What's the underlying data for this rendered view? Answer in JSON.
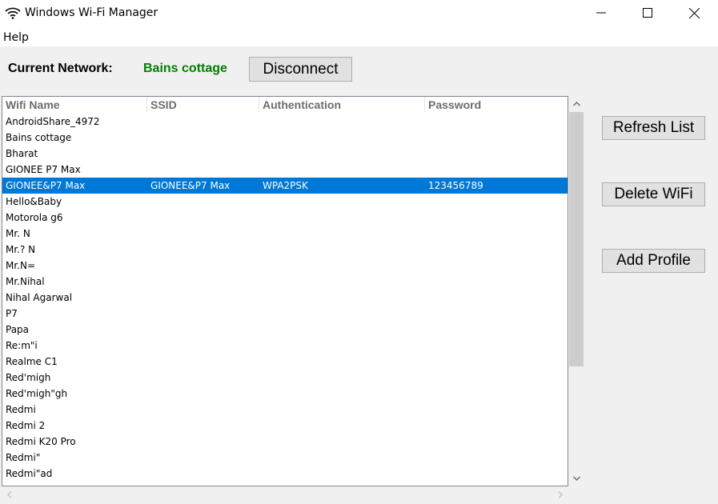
{
  "window": {
    "title": "Windows Wi-Fi Manager",
    "icon": "wifi-icon",
    "controls": [
      "minimize",
      "maximize",
      "close"
    ]
  },
  "menu": {
    "items": [
      {
        "label": "Help"
      }
    ]
  },
  "current_network": {
    "label": "Current Network:",
    "value": "Bains cottage",
    "value_color": "#008000",
    "disconnect_label": "Disconnect"
  },
  "table": {
    "columns": [
      "Wifi Name",
      "SSID",
      "Authentication",
      "Password"
    ],
    "rows": [
      {
        "name": "AndroidShare_4972",
        "ssid": "",
        "auth": "",
        "password": ""
      },
      {
        "name": "Bains cottage",
        "ssid": "",
        "auth": "",
        "password": ""
      },
      {
        "name": "Bharat",
        "ssid": "",
        "auth": "",
        "password": ""
      },
      {
        "name": "GIONEE P7 Max",
        "ssid": "",
        "auth": "",
        "password": ""
      },
      {
        "name": "GIONEE&P7 Max",
        "ssid": "GIONEE&P7 Max",
        "auth": "WPA2PSK",
        "password": "123456789",
        "selected": true
      },
      {
        "name": "Hello&Baby",
        "ssid": "",
        "auth": "",
        "password": ""
      },
      {
        "name": "Motorola g6",
        "ssid": "",
        "auth": "",
        "password": ""
      },
      {
        "name": "Mr. N",
        "ssid": "",
        "auth": "",
        "password": ""
      },
      {
        "name": "Mr.? N",
        "ssid": "",
        "auth": "",
        "password": ""
      },
      {
        "name": "Mr.N=",
        "ssid": "",
        "auth": "",
        "password": ""
      },
      {
        "name": "Mr.Nihal",
        "ssid": "",
        "auth": "",
        "password": ""
      },
      {
        "name": "Nihal Agarwal",
        "ssid": "",
        "auth": "",
        "password": ""
      },
      {
        "name": "P7",
        "ssid": "",
        "auth": "",
        "password": ""
      },
      {
        "name": "Papa",
        "ssid": "",
        "auth": "",
        "password": ""
      },
      {
        "name": "Re:m\"i",
        "ssid": "",
        "auth": "",
        "password": ""
      },
      {
        "name": "Realme C1",
        "ssid": "",
        "auth": "",
        "password": ""
      },
      {
        "name": "Red'migh",
        "ssid": "",
        "auth": "",
        "password": ""
      },
      {
        "name": "Red'migh\"gh",
        "ssid": "",
        "auth": "",
        "password": ""
      },
      {
        "name": "Redmi",
        "ssid": "",
        "auth": "",
        "password": ""
      },
      {
        "name": "Redmi 2",
        "ssid": "",
        "auth": "",
        "password": ""
      },
      {
        "name": "Redmi K20 Pro",
        "ssid": "",
        "auth": "",
        "password": ""
      },
      {
        "name": "Redmi\"",
        "ssid": "",
        "auth": "",
        "password": ""
      },
      {
        "name": "Redmi\"ad",
        "ssid": "",
        "auth": "",
        "password": ""
      }
    ],
    "selected_color": "#0078d7"
  },
  "actions": {
    "refresh_label": "Refresh List",
    "delete_label": "Delete WiFi",
    "add_label": "Add Profile"
  }
}
